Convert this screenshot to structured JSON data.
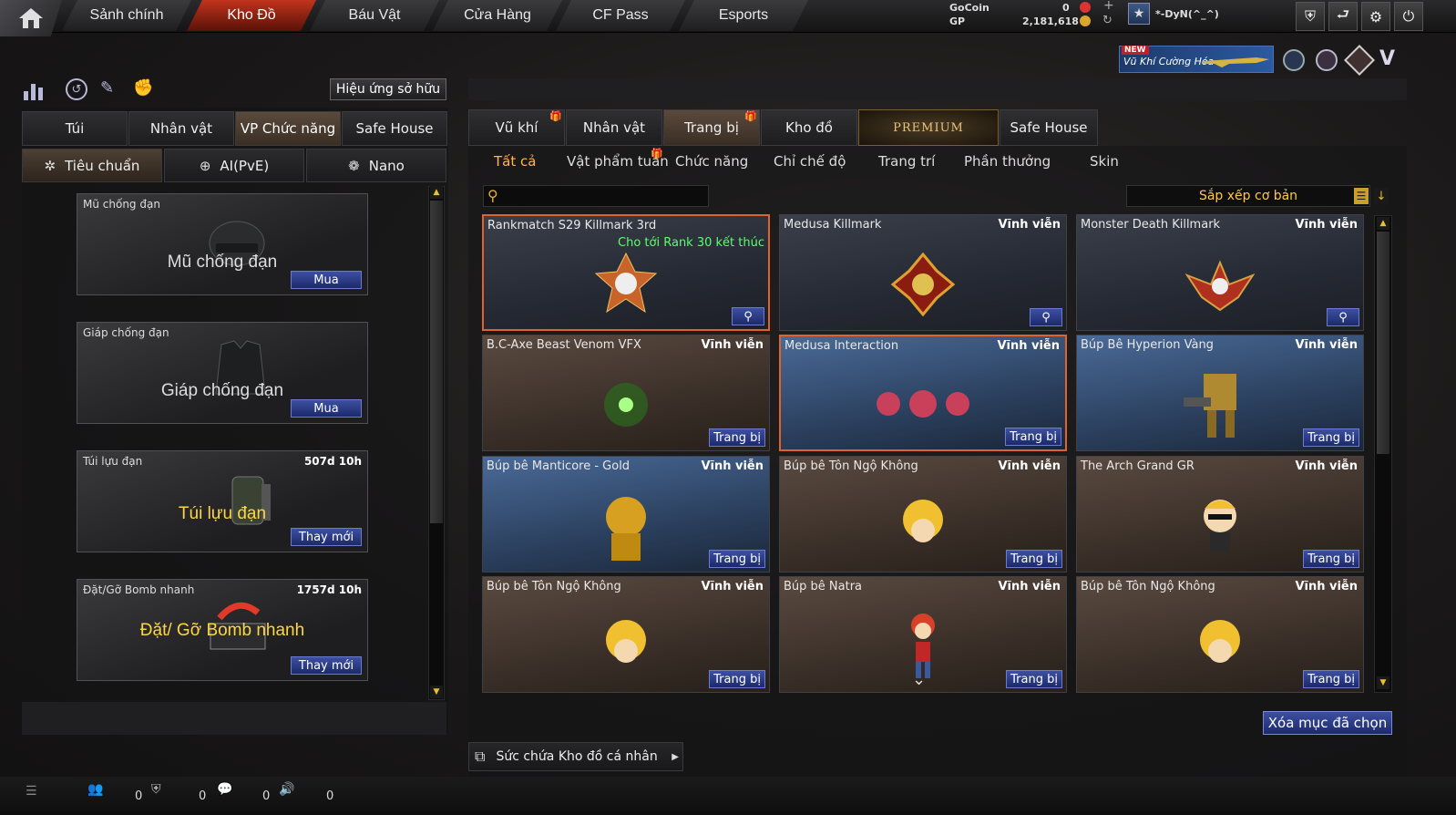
{
  "topnav": {
    "tabs": [
      "Sảnh chính",
      "Kho Đồ",
      "Báu Vật",
      "Cửa Hàng",
      "CF Pass",
      "Esports"
    ],
    "active_tab": "Kho Đồ",
    "gocoin_label": "GoCoin",
    "gocoin_value": "0",
    "gp_label": "GP",
    "gp_value": "2,181,618",
    "username": "*-DyN(^_^)",
    "promo_badge": "NEW",
    "promo_text": "Vũ Khí Cường Hóa"
  },
  "left": {
    "owned_effects_button": "Hiệu ứng sở hữu",
    "tabs": [
      "Túi",
      "Nhân vật",
      "VP Chức năng",
      "Safe House"
    ],
    "active_tab": "VP Chức năng",
    "subtabs": [
      "Tiêu chuẩn",
      "AI(PvE)",
      "Nano"
    ],
    "cards": [
      {
        "name": "Mũ chống đạn",
        "duration": "",
        "big": "Mũ chống đạn",
        "button": "Mua"
      },
      {
        "name": "Giáp chống đạn",
        "duration": "",
        "big": "Giáp chống đạn",
        "button": "Mua"
      },
      {
        "name": "Túi lựu đạn",
        "duration": "507d 10h",
        "big": "Túi lựu đạn",
        "button": "Thay mới"
      },
      {
        "name": "Đặt/Gỡ Bomb nhanh",
        "duration": "1757d 10h",
        "big": "Đặt/ Gỡ Bomb nhanh",
        "button": "Thay mới"
      }
    ]
  },
  "right": {
    "tabs": [
      "Vũ khí",
      "Nhân vật",
      "Trang bị",
      "Kho đồ",
      "PREMIUM",
      "Safe House"
    ],
    "active_tab": "Trang bị",
    "filters": [
      "Tất cả",
      "Vật phẩm tuần",
      "Chức năng",
      "Chỉ chế độ",
      "Trang trí",
      "Phần thưởng",
      "Skin"
    ],
    "active_filter": "Tất cả",
    "search_placeholder": "",
    "sort_label": "Sắp xếp cơ bản",
    "items": [
      {
        "name": "Rankmatch S29 Killmark 3rd",
        "duration": "",
        "note": "Cho tới Rank 30 kết thúc",
        "action": "zoom"
      },
      {
        "name": "Medusa Killmark",
        "duration": "Vĩnh viễn",
        "note": "",
        "action": "zoom"
      },
      {
        "name": "Monster Death Killmark",
        "duration": "Vĩnh viễn",
        "note": "",
        "action": "zoom"
      },
      {
        "name": "B.C-Axe Beast Venom VFX",
        "duration": "Vĩnh viễn",
        "note": "",
        "action": "Trang bị"
      },
      {
        "name": "Medusa Interaction",
        "duration": "Vĩnh viễn",
        "note": "",
        "action": "Trang bị"
      },
      {
        "name": "Búp Bê Hyperion Vàng",
        "duration": "Vĩnh viễn",
        "note": "",
        "action": "Trang bị"
      },
      {
        "name": "Búp bê Manticore - Gold",
        "duration": "Vĩnh viễn",
        "note": "",
        "action": "Trang bị"
      },
      {
        "name": "Búp bê Tôn Ngộ Không",
        "duration": "Vĩnh viễn",
        "note": "",
        "action": "Trang bị"
      },
      {
        "name": "The Arch Grand GR",
        "duration": "Vĩnh viễn",
        "note": "",
        "action": "Trang bị"
      },
      {
        "name": "Búp bê Tôn Ngộ Không",
        "duration": "Vĩnh viễn",
        "note": "",
        "action": "Trang bị"
      },
      {
        "name": "Búp bê Natra",
        "duration": "Vĩnh viễn",
        "note": "",
        "action": "Trang bị"
      },
      {
        "name": "Búp bê Tôn Ngộ Không",
        "duration": "Vĩnh viễn",
        "note": "",
        "action": "Trang bị"
      }
    ],
    "clear_button": "Xóa mục đã chọn",
    "capacity_label": "Sức chứa Kho đồ cá nhân"
  },
  "bottom": {
    "counts": [
      "0",
      "0",
      "0",
      "0"
    ]
  },
  "colors": {
    "accent_red": "#c0341c",
    "button_blue": "#2c3c88",
    "active_filter": "#ffb74a",
    "note_green": "#5dff6c"
  }
}
